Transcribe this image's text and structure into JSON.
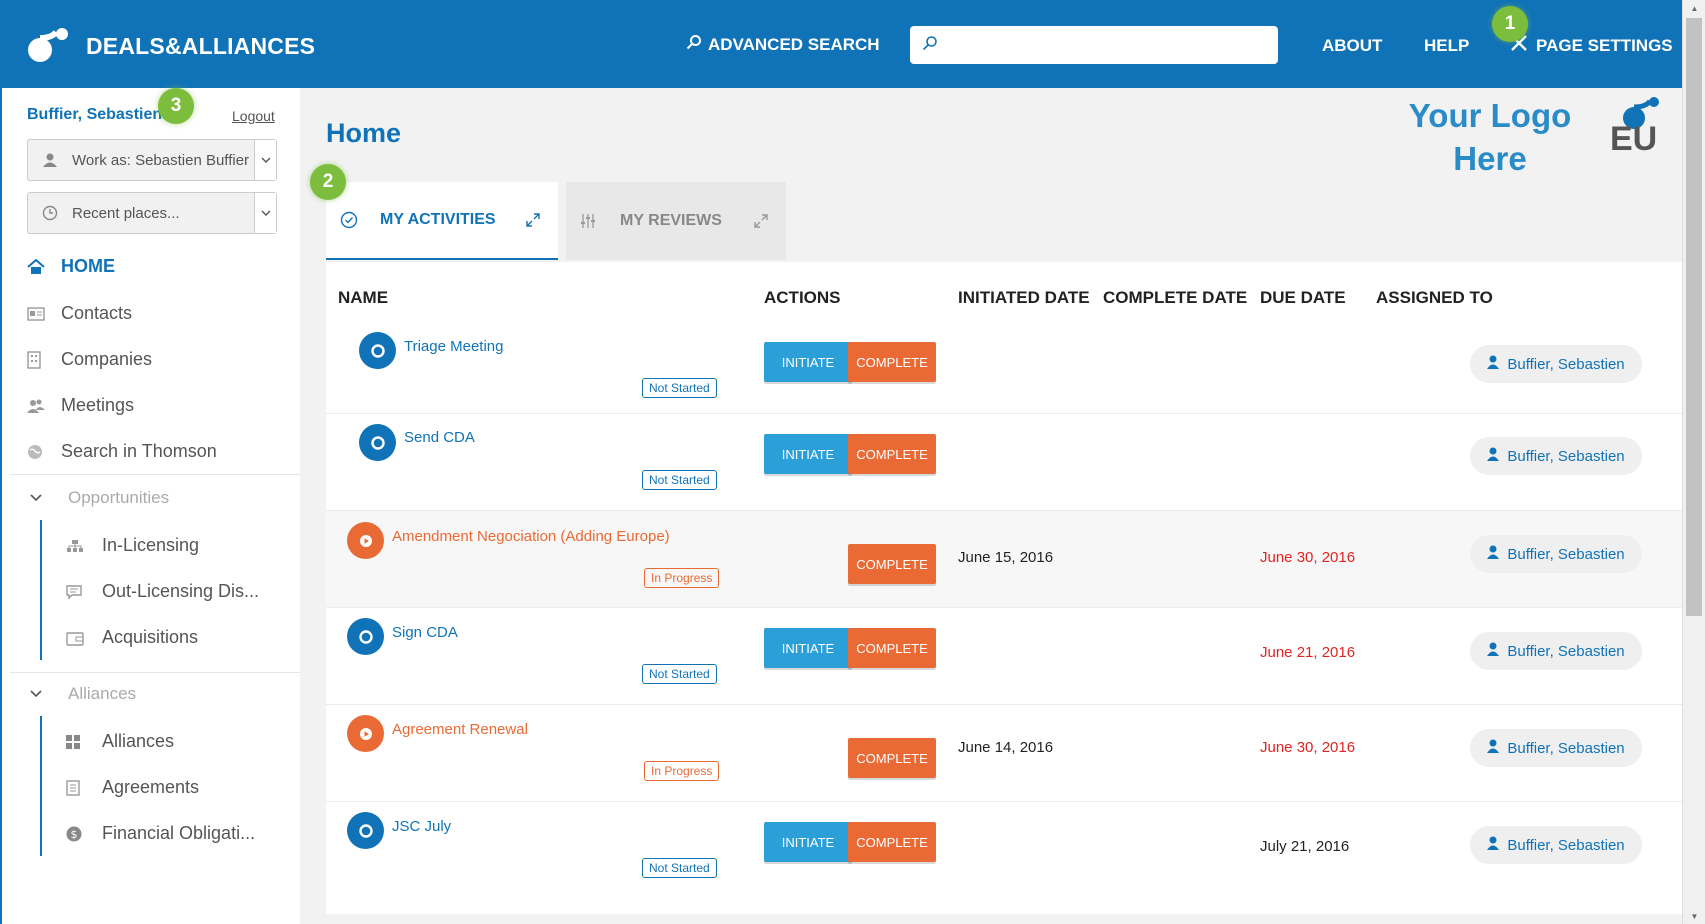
{
  "header": {
    "brand": "DEALS&ALLIANCES",
    "advanced_search": "ADVANCED SEARCH",
    "search_placeholder": "",
    "about": "ABOUT",
    "help": "HELP",
    "page_settings": "PAGE SETTINGS",
    "color": "#1173b7"
  },
  "badges": {
    "one": "1",
    "two": "2",
    "three": "3"
  },
  "sidebar": {
    "user": "Buffier, Sebastien",
    "logout": "Logout",
    "work_as": "Work as: Sebastien Buffier",
    "recent": "Recent places...",
    "nav": [
      {
        "label": "HOME",
        "icon": "home-icon"
      },
      {
        "label": "Contacts",
        "icon": "contact-card-icon"
      },
      {
        "label": "Companies",
        "icon": "building-icon"
      },
      {
        "label": "Meetings",
        "icon": "people-icon"
      },
      {
        "label": "Search in Thomson",
        "icon": "globe-icon"
      }
    ],
    "opportunities": {
      "label": "Opportunities",
      "items": [
        {
          "label": "In-Licensing",
          "icon": "org-chart-icon"
        },
        {
          "label": "Out-Licensing Dis...",
          "icon": "chat-icon"
        },
        {
          "label": "Acquisitions",
          "icon": "wallet-icon"
        }
      ]
    },
    "alliances": {
      "label": "Alliances",
      "items": [
        {
          "label": "Alliances",
          "icon": "grid-icon"
        },
        {
          "label": "Agreements",
          "icon": "document-icon"
        },
        {
          "label": "Financial Obligati...",
          "icon": "dollar-icon"
        }
      ]
    }
  },
  "main": {
    "title": "Home",
    "logo_text_line1": "Your Logo",
    "logo_text_line2": "Here",
    "logo_eu": "EU",
    "tabs": [
      {
        "label": "MY ACTIVITIES",
        "active": true
      },
      {
        "label": "MY REVIEWS",
        "active": false
      }
    ],
    "columns": [
      "NAME",
      "ACTIONS",
      "INITIATED DATE",
      "COMPLETE DATE",
      "DUE DATE",
      "ASSIGNED TO"
    ],
    "buttons": {
      "initiate": "INITIATE",
      "complete": "COMPLETE"
    },
    "rows": [
      {
        "name": "Triage Meeting",
        "status": "Not Started",
        "initiated": "",
        "complete": "",
        "due": "",
        "assignee": "Buffier, Sebastien"
      },
      {
        "name": "Send CDA",
        "status": "Not Started",
        "initiated": "",
        "complete": "",
        "due": "",
        "assignee": "Buffier, Sebastien"
      },
      {
        "name": "Amendment Negociation (Adding Europe)",
        "status": "In Progress",
        "initiated": "June 15, 2016",
        "complete": "",
        "due": "June 30, 2016",
        "assignee": "Buffier, Sebastien"
      },
      {
        "name": "Sign CDA",
        "status": "Not Started",
        "initiated": "",
        "complete": "",
        "due": "June 21, 2016",
        "assignee": "Buffier, Sebastien"
      },
      {
        "name": "Agreement Renewal",
        "status": "In Progress",
        "initiated": "June 14, 2016",
        "complete": "",
        "due": "June 30, 2016",
        "assignee": "Buffier, Sebastien"
      },
      {
        "name": "JSC July",
        "status": "Not Started",
        "initiated": "",
        "complete": "",
        "due": "July 21, 2016",
        "assignee": "Buffier, Sebastien"
      }
    ]
  },
  "colors": {
    "primary": "#1173b7",
    "initiate": "#2a9fd8",
    "complete": "#ea6a35",
    "overdue": "#e02424",
    "badge": "#7dbd3e"
  }
}
